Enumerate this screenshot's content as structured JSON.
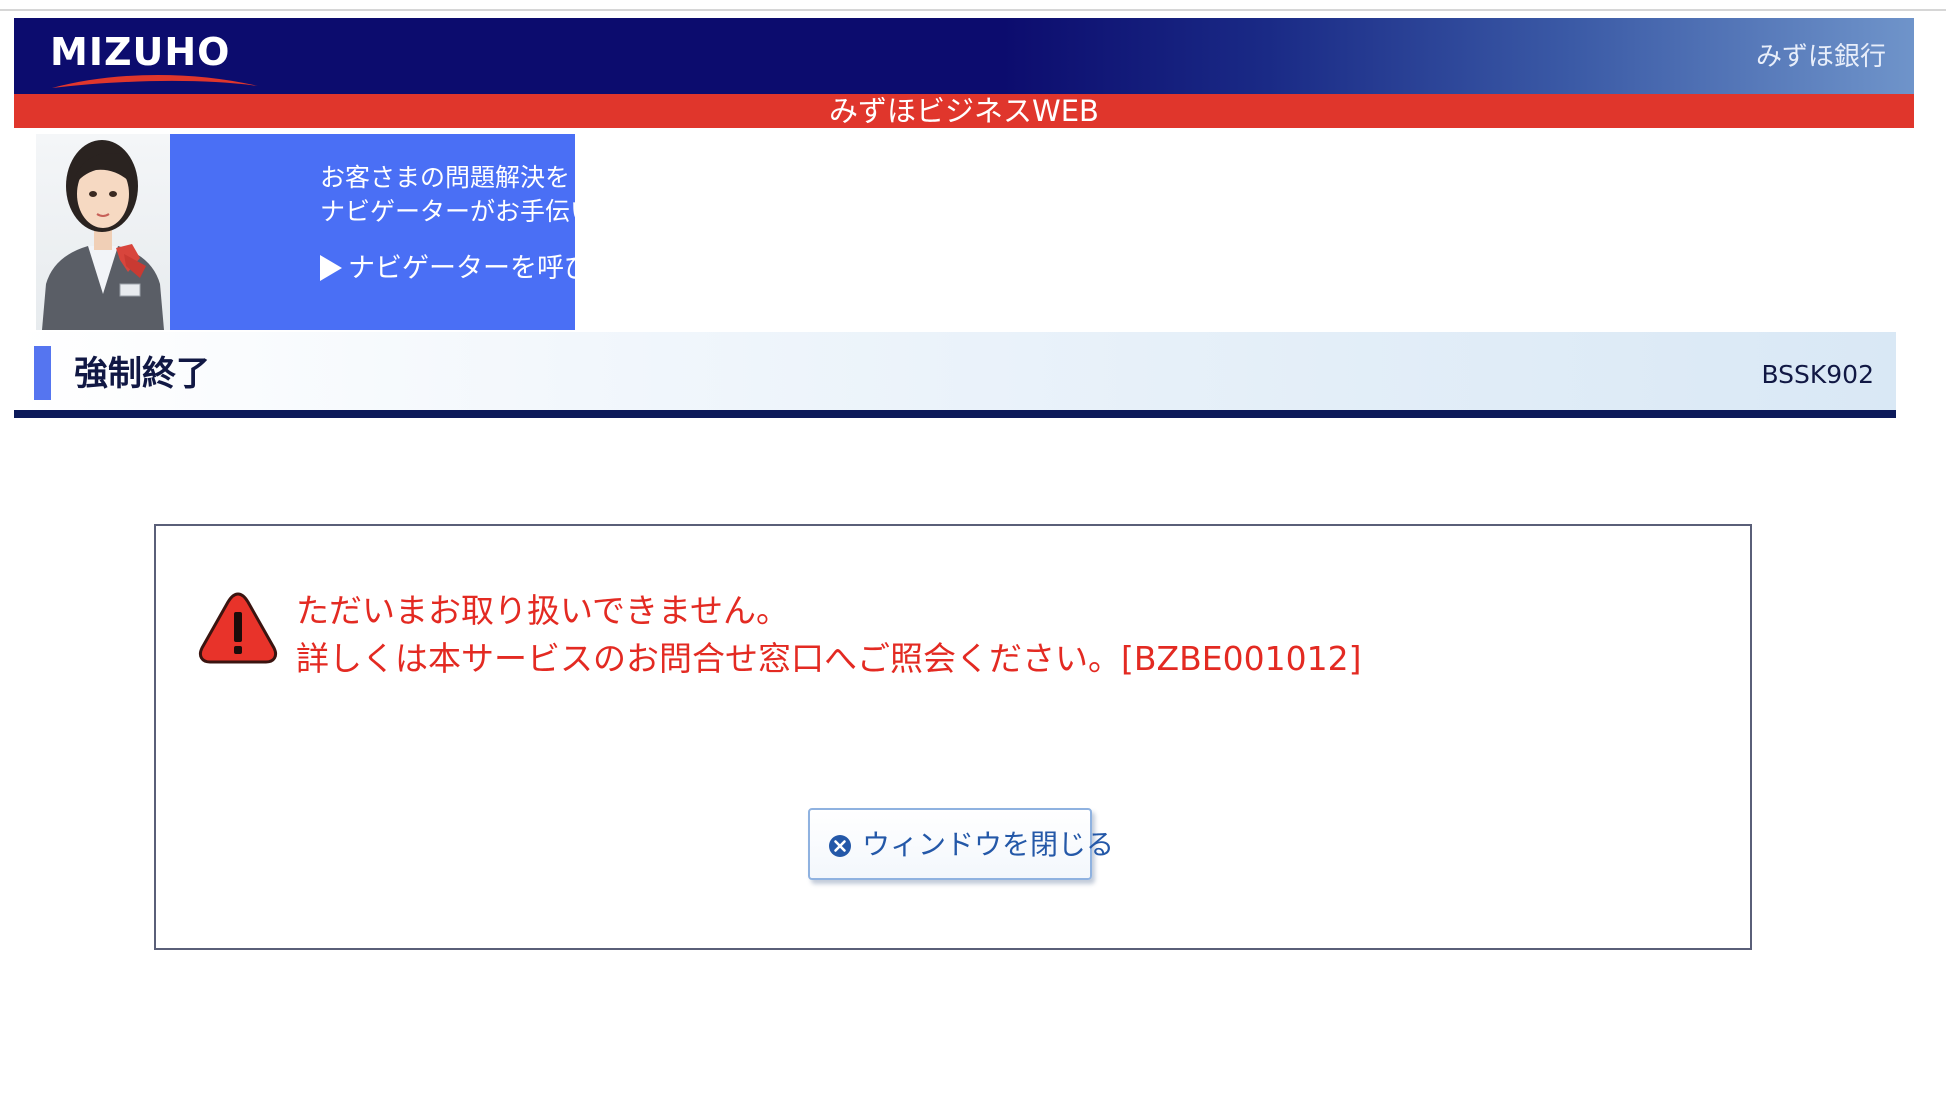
{
  "header": {
    "logo_text": "MIZUHO",
    "bank_name": "みずほ銀行",
    "service_name": "みずほビジネスWEB"
  },
  "navigator": {
    "line1": "お客さまの問題解決を",
    "line2": "ナビゲーターがお手伝いします",
    "link_label": "ナビゲーターを呼び出す"
  },
  "page": {
    "title": "強制終了",
    "screen_id": "BSSK902"
  },
  "message": {
    "line1": "ただいまお取り扱いできません。",
    "line2": "詳しくは本サービスのお問合せ窓口へご照会ください。[BZBE001012]",
    "icon": "warning-icon"
  },
  "actions": {
    "close_window_label": "ウィンドウを閉じる",
    "close_window_icon": "close-circle-icon"
  },
  "colors": {
    "header_navy": "#0c0c6e",
    "service_red": "#e0362c",
    "navigator_blue": "#4a6ff5",
    "error_red": "#e32a22",
    "button_text_blue": "#2458a8"
  }
}
